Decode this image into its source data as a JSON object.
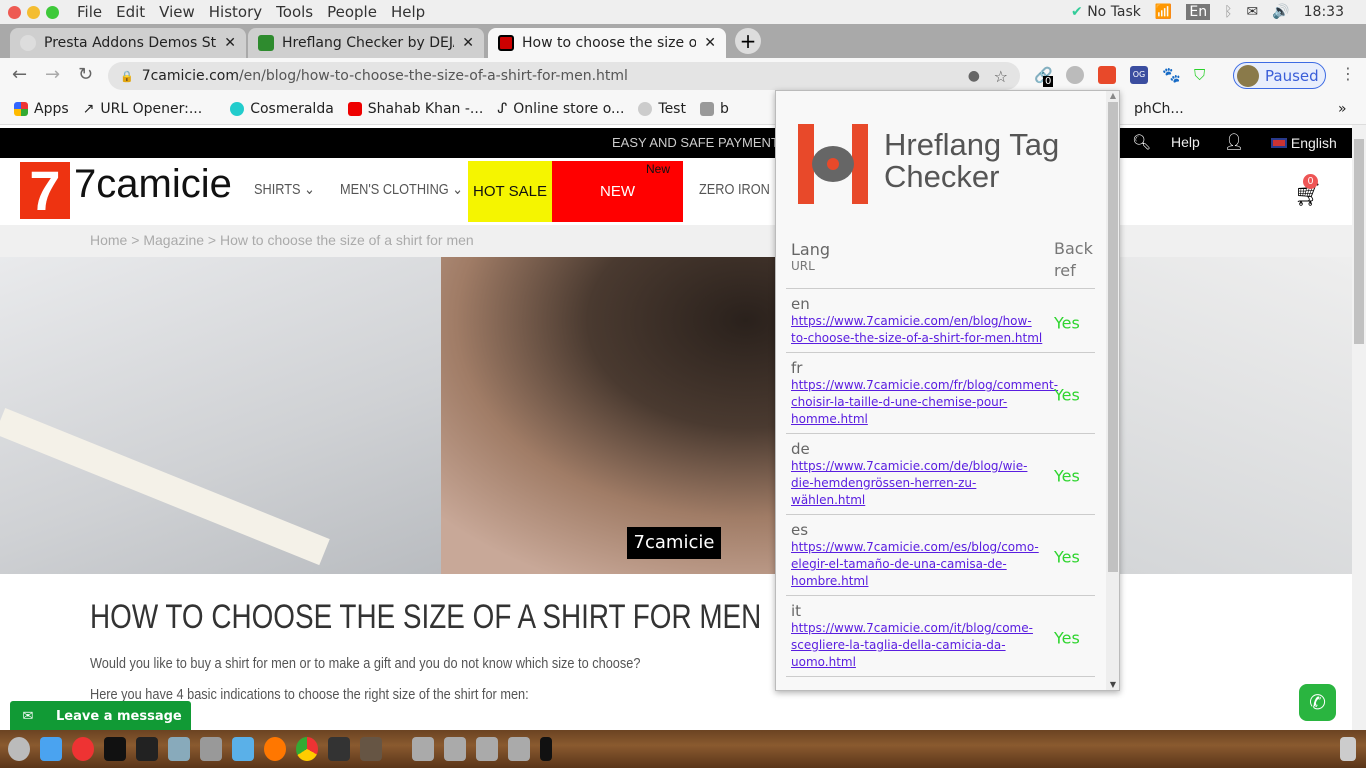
{
  "menubar": {
    "items": [
      "File",
      "Edit",
      "View",
      "History",
      "Tools",
      "People",
      "Help"
    ],
    "tray": {
      "task": "No Task",
      "keyboard": "En",
      "time": "18:33"
    }
  },
  "tabs": [
    {
      "title": "Presta Addons Demos Sto",
      "badge": "0"
    },
    {
      "title": "Hreflang Checker by DEJA"
    },
    {
      "title": "How to choose the size of"
    }
  ],
  "toolbar": {
    "url_domain": "7camicie.com",
    "url_path": "/en/blog/how-to-choose-the-size-of-a-shirt-for-men.html",
    "ext_badge": "0",
    "profile": "Paused"
  },
  "bookmarks": [
    "Apps",
    "URL Opener:...",
    "Cosmeralda",
    "Shahab Khan -...",
    "Online store o...",
    "Test",
    "b",
    "phCh..."
  ],
  "site": {
    "topbar": {
      "promo": "EASY AND SAFE PAYMENT",
      "help": "Help",
      "language": "English"
    },
    "logo": "7camicie",
    "nav": [
      {
        "label": "SHIRTS"
      },
      {
        "label": "MEN'S CLOTHING"
      },
      {
        "label": "HOT SALE"
      },
      {
        "label": "NEW COLLECTION",
        "badge": "New"
      },
      {
        "label": "ZERO IRON"
      }
    ],
    "cart_count": "0",
    "breadcrumb": [
      "Home",
      ">",
      "Magazine",
      ">",
      "How to choose the size of a shirt for men"
    ],
    "hero_watermark": "7camicie",
    "title": "HOW TO CHOOSE THE SIZE OF A SHIRT FOR MEN",
    "paragraphs": [
      "Would you like to buy a shirt for men or to make a gift and you do not know which size to choose?",
      "Here you have 4 basic indications to choose the right size of the shirt for men:"
    ],
    "leave_message": "Leave a message"
  },
  "popup": {
    "title_line1": "Hreflang Tag",
    "title_line2": "Checker",
    "col_lang": "Lang",
    "col_url": "URL",
    "col_back": "Back ref",
    "rows": [
      {
        "lang": "en",
        "url": "https://www.7camicie.com/en/blog/how-to-choose-the-size-of-a-shirt-for-men.html",
        "back": "Yes"
      },
      {
        "lang": "fr",
        "url": "https://www.7camicie.com/fr/blog/comment-choisir-la-taille-d-une-chemise-pour-homme.html",
        "back": "Yes"
      },
      {
        "lang": "de",
        "url": "https://www.7camicie.com/de/blog/wie-die-hemdengrössen-herren-zu-wählen.html",
        "back": "Yes"
      },
      {
        "lang": "es",
        "url": "https://www.7camicie.com/es/blog/como-elegir-el-tamaño-de-una-camisa-de-hombre.html",
        "back": "Yes"
      },
      {
        "lang": "it",
        "url": "https://www.7camicie.com/it/blog/come-scegliere-la-taglia-della-camicia-da-uomo.html",
        "back": "Yes"
      }
    ]
  },
  "colors": {
    "hot_sale": "#f5f500",
    "new_collection": "#ff0000",
    "yes": "#2fd52f",
    "link": "#5a1ee0",
    "leave_message": "#119a35"
  }
}
